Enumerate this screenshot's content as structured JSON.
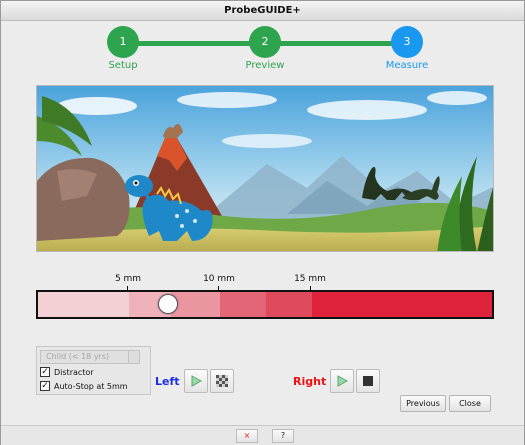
{
  "window": {
    "title": "ProbeGUIDE+"
  },
  "steps": [
    {
      "number": "1",
      "label": "Setup",
      "state": "done"
    },
    {
      "number": "2",
      "label": "Preview",
      "state": "done"
    },
    {
      "number": "3",
      "label": "Measure",
      "state": "active"
    }
  ],
  "colors": {
    "step_done": "#2ea44f",
    "step_active": "#1a97ee",
    "left_label": "#1a2ee8",
    "right_label": "#ee1111"
  },
  "scene": {
    "description_icon": "dinosaur-landscape-illustration"
  },
  "ruler": {
    "ticks": [
      {
        "label": "5 mm"
      },
      {
        "label": "10 mm"
      },
      {
        "label": "15 mm"
      }
    ]
  },
  "depth_bar": {
    "segment_colors": [
      "#f2d0d4",
      "#efb2ba",
      "#ea96a0",
      "#e36676",
      "#df4a5d",
      "#e0233c"
    ],
    "slider_value_mm": 7
  },
  "settings": {
    "age_group": {
      "selected": "Child (< 18 yrs)"
    },
    "distractor": {
      "label": "Distractor",
      "checked": "✓"
    },
    "auto_stop": {
      "label": "Auto-Stop at 5mm",
      "checked": "✓"
    }
  },
  "controls": {
    "left_label": "Left",
    "right_label": "Right",
    "left_play_icon": "play-icon",
    "left_pattern_icon": "checkerboard-icon",
    "right_play_icon": "play-icon",
    "right_stop_icon": "stop-icon"
  },
  "nav": {
    "previous": "Previous",
    "close": "Close"
  },
  "statusbar": {
    "close_glyph": "×",
    "help_glyph": "?"
  }
}
